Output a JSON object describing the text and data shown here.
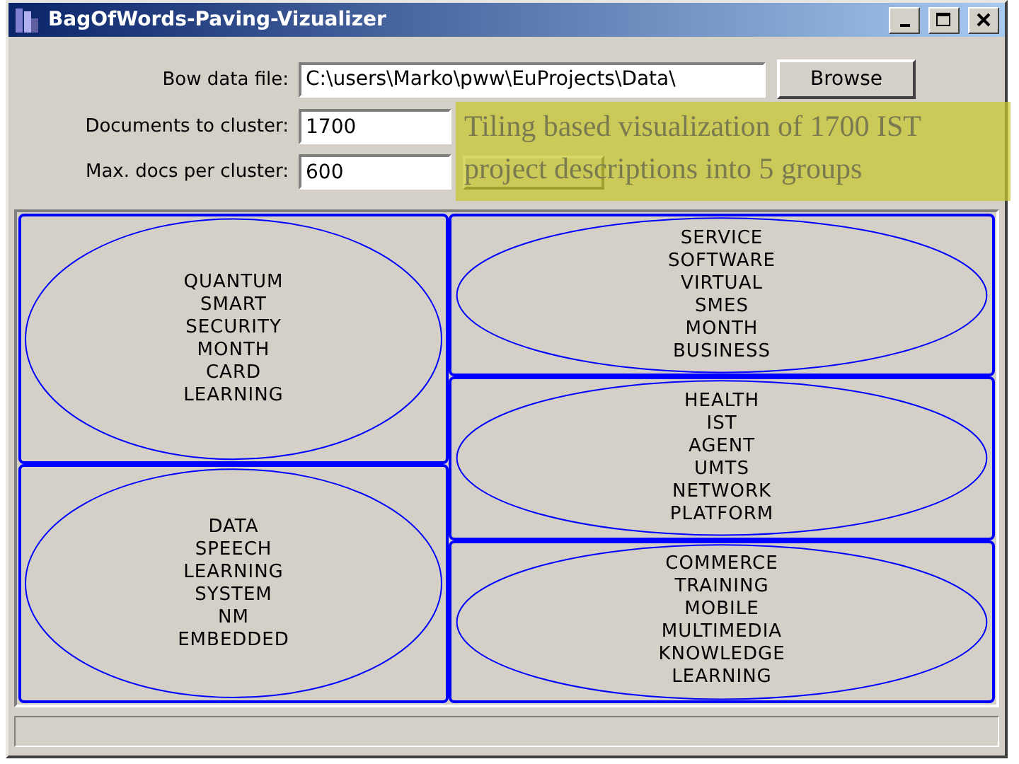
{
  "window": {
    "title": "BagOfWords-Paving-Vizualizer"
  },
  "form": {
    "fields": [
      {
        "label": "Bow data file:",
        "value": "C:\\users\\Marko\\pww\\EuProjects\\Data\\",
        "kind": "wide"
      },
      {
        "label": "Documents to cluster:",
        "value": "1700",
        "kind": "short"
      },
      {
        "label": "Max. docs per cluster:",
        "value": "600",
        "kind": "short"
      }
    ],
    "browse_button": "Browse"
  },
  "caption": "Tiling based visualization of 1700 IST project descriptions into 5 groups",
  "clusters": [
    {
      "tiles": [
        {
          "words": [
            "QUANTUM",
            "SMART",
            "SECURITY",
            "MONTH",
            "CARD",
            "LEARNING"
          ]
        },
        {
          "words": [
            "DATA",
            "SPEECH",
            "LEARNING",
            "SYSTEM",
            "NM",
            "EMBEDDED"
          ]
        }
      ]
    },
    {
      "tiles": [
        {
          "words": [
            "SERVICE",
            "SOFTWARE",
            "VIRTUAL",
            "SMES",
            "MONTH",
            "BUSINESS"
          ]
        },
        {
          "words": [
            "HEALTH",
            "IST",
            "AGENT",
            "UMTS",
            "NETWORK",
            "PLATFORM"
          ]
        },
        {
          "words": [
            "COMMERCE",
            "TRAINING",
            "MOBILE",
            "MULTIMEDIA",
            "KNOWLEDGE",
            "LEARNING"
          ]
        }
      ]
    }
  ]
}
